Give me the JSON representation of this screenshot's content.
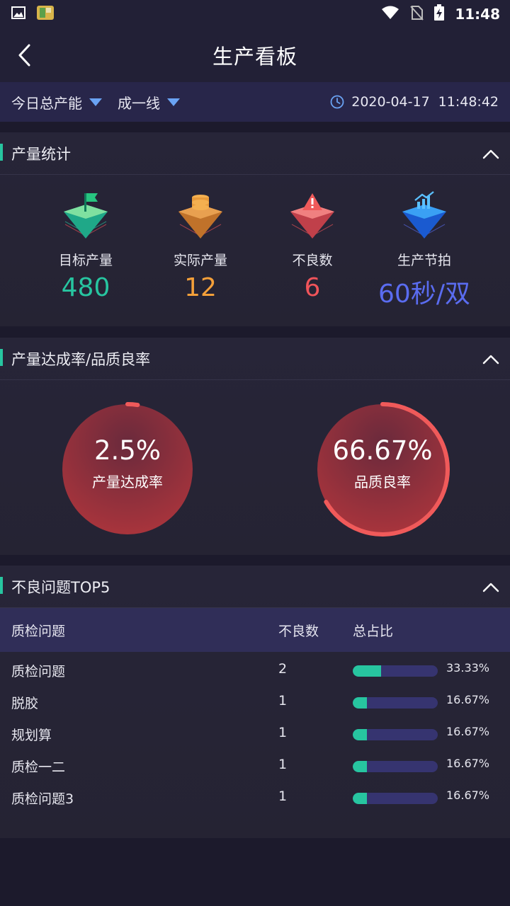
{
  "status_bar": {
    "time": "11:48",
    "icons": [
      "image-icon",
      "app-icon",
      "wifi-icon",
      "no-sim-icon",
      "battery-charging-icon"
    ]
  },
  "header": {
    "title": "生产看板"
  },
  "filters": {
    "capacity": "今日总产能",
    "line": "成一线",
    "date": "2020-04-17",
    "time": "11:48:42"
  },
  "stats_card": {
    "title": "产量统计",
    "items": [
      {
        "label": "目标产量",
        "value": "480",
        "color": "#27c5a0",
        "icon": "flag-icon"
      },
      {
        "label": "实际产量",
        "value": "12",
        "color": "#f4a03a",
        "icon": "coins-icon"
      },
      {
        "label": "不良数",
        "value": "6",
        "color": "#f0545a",
        "icon": "warning-icon"
      },
      {
        "label": "生产节拍",
        "value": "60秒/双",
        "color": "#5a6cf0",
        "icon": "trend-chart-icon"
      }
    ]
  },
  "rate_card": {
    "title": "产量达成率/品质良率",
    "gauges": [
      {
        "value": "2.5%",
        "label": "产量达成率",
        "fraction": 0.025
      },
      {
        "value": "66.67%",
        "label": "品质良率",
        "fraction": 0.6667
      }
    ]
  },
  "top5_card": {
    "title": "不良问题TOP5",
    "columns": [
      "质检问题",
      "不良数",
      "总占比"
    ],
    "rows": [
      {
        "name": "质检问题",
        "count": "2",
        "percent": "33.33%",
        "fraction": 0.3333
      },
      {
        "name": "脱胶",
        "count": "1",
        "percent": "16.67%",
        "fraction": 0.1667
      },
      {
        "name": "规划算",
        "count": "1",
        "percent": "16.67%",
        "fraction": 0.1667
      },
      {
        "name": "质检一二",
        "count": "1",
        "percent": "16.67%",
        "fraction": 0.1667
      },
      {
        "name": "质检问题3",
        "count": "1",
        "percent": "16.67%",
        "fraction": 0.1667
      }
    ]
  }
}
